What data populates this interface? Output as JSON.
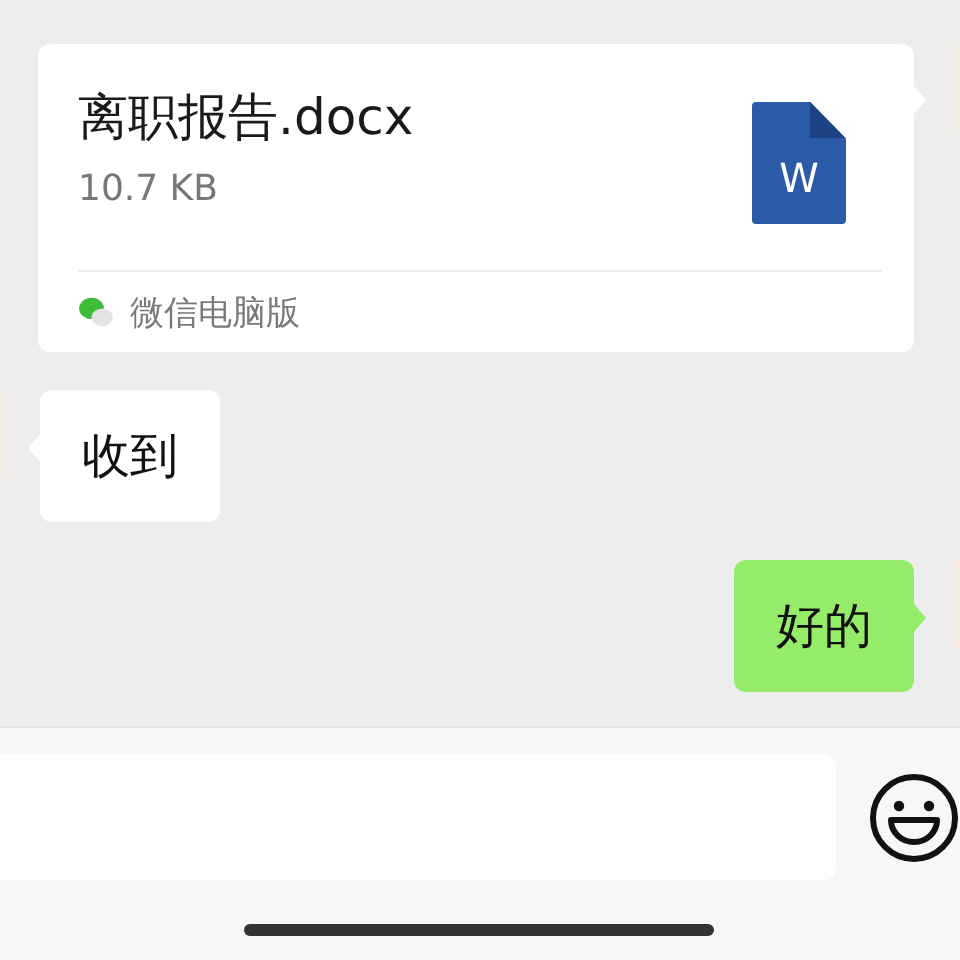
{
  "messages": [
    {
      "kind": "file",
      "outgoing": true,
      "file_name": "离职报告.docx",
      "file_size": "10.7 KB",
      "file_badge": "W",
      "source": "微信电脑版"
    },
    {
      "kind": "text",
      "outgoing": false,
      "text": "收到"
    },
    {
      "kind": "text",
      "outgoing": true,
      "text": "好的"
    }
  ]
}
